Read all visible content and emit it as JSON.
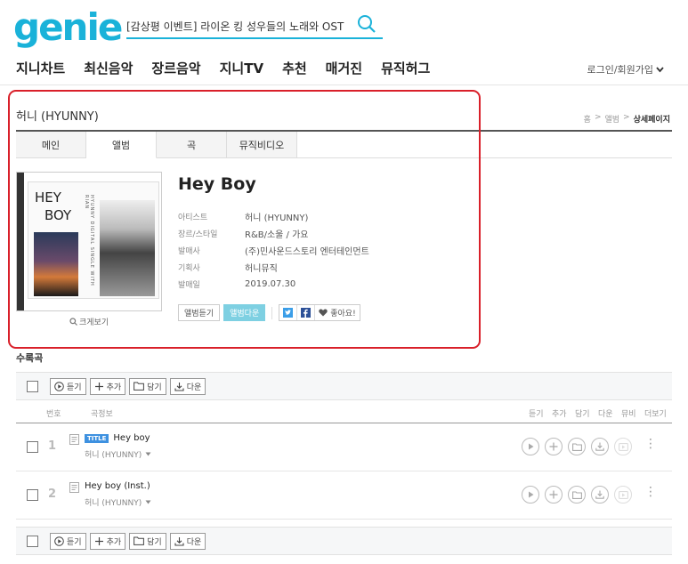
{
  "header": {
    "logo": "genie",
    "search_value": "[감상평 이벤트] 라이온 킹 성우들의 노래와 OST",
    "nav": [
      "지니차트",
      "최신음악",
      "장르음악",
      "지니TV",
      "추천",
      "매거진",
      "뮤직허그"
    ],
    "login": "로그인/회원가입"
  },
  "artist_header": {
    "name": "허니 (HYUNNY)",
    "breadcrumb": [
      "홈",
      ">",
      "앨범",
      ">",
      "상세페이지"
    ]
  },
  "tabs": [
    "메인",
    "앨범",
    "곡",
    "뮤직비디오"
  ],
  "album": {
    "cover_text_line1": "HEY",
    "cover_text_line2": "BOY",
    "cover_side_text": "HYUNNY DIGITAL SINGLE WITH RIAN",
    "zoom_label": "크게보기",
    "title": "Hey Boy",
    "info": [
      {
        "label": "아티스트",
        "value": "허니 (HYUNNY)"
      },
      {
        "label": "장르/스타일",
        "value": "R&B/소울 / 가요"
      },
      {
        "label": "발매사",
        "value": "(주)민사운드스토리 엔터테인먼트"
      },
      {
        "label": "기획사",
        "value": "허니뮤직"
      },
      {
        "label": "발매일",
        "value": "2019.07.30"
      }
    ],
    "btn_listen": "앨범듣기",
    "btn_download": "앨범다운",
    "like": "좋아요!"
  },
  "tracks": {
    "section_title": "수록곡",
    "toolbar": {
      "listen": "듣기",
      "add": "추가",
      "save": "담기",
      "download": "다운"
    },
    "columns": {
      "no": "번호",
      "info": "곡정보",
      "listen": "듣기",
      "add": "추가",
      "save": "담기",
      "down": "다운",
      "mv": "뮤비",
      "more": "더보기"
    },
    "rows": [
      {
        "num": "1",
        "badge": "TITLE",
        "title": "Hey boy",
        "artist": "허니 (HYUNNY)"
      },
      {
        "num": "2",
        "badge": "",
        "title": "Hey boy (Inst.)",
        "artist": "허니 (HYUNNY)"
      }
    ]
  },
  "colors": {
    "brand": "#1ab2d9",
    "highlight": "#d9202a",
    "accent_btn": "#7ed0e2",
    "title_badge": "#3e91e0"
  }
}
